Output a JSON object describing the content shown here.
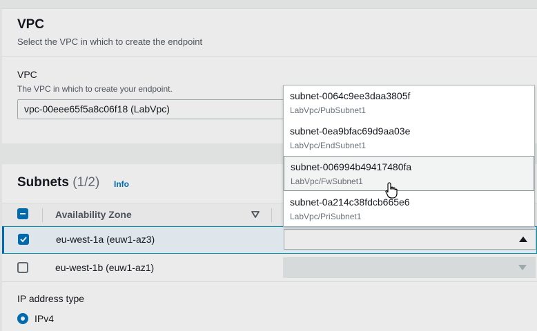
{
  "vpc_section": {
    "title": "VPC",
    "description": "Select the VPC in which to create the endpoint",
    "field_label": "VPC",
    "field_description": "The VPC in which to create your endpoint.",
    "selected_vpc": "vpc-00eee65f5a8c06f18 (LabVpc)"
  },
  "subnets_section": {
    "title": "Subnets",
    "count": "(1/2)",
    "info_link": "Info",
    "column_header": "Availability Zone",
    "rows": [
      {
        "az": "eu-west-1a (euw1-az3)",
        "checked": true
      },
      {
        "az": "eu-west-1b (euw1-az1)",
        "checked": false
      }
    ]
  },
  "subnet_dropdown": {
    "options": [
      {
        "id": "subnet-0064c9ee3daa3805f",
        "tag": "LabVpc/PubSubnet1"
      },
      {
        "id": "subnet-0ea9bfac69d9aa03e",
        "tag": "LabVpc/EndSubnet1"
      },
      {
        "id": "subnet-006994b49417480fa",
        "tag": "LabVpc/FwSubnet1"
      },
      {
        "id": "subnet-0a214c38fdcb665e6",
        "tag": "LabVpc/PriSubnet1"
      }
    ],
    "hovered_index": 2
  },
  "ip_section": {
    "label": "IP address type",
    "option": "IPv4"
  },
  "icons": {
    "sort": "sort-down-icon",
    "caret_up": "caret-up-icon",
    "caret_down": "caret-down-icon",
    "cursor": "hand-pointer-icon"
  },
  "colors": {
    "accent": "#0073bb",
    "selected_row_bg": "#f1faff"
  }
}
